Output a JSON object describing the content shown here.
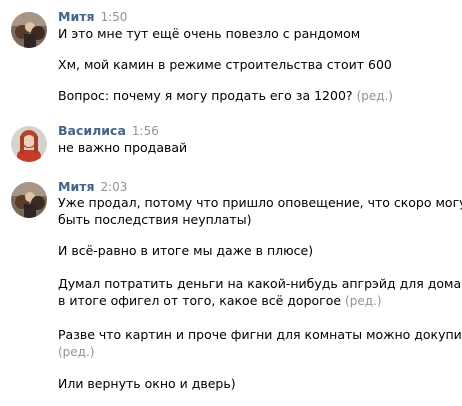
{
  "messages": [
    {
      "author": "Митя",
      "time": "1:50",
      "lines": [
        "И это мне тут ещё очень повезло с рандомом",
        "Хм, мой камин в режиме строительства стоит 600",
        "Вопрос: почему я могу продать его за 1200?"
      ],
      "edited_label": "(ред.)"
    },
    {
      "author": "Василиса",
      "time": "1:56",
      "lines": [
        "не важно продавай"
      ]
    },
    {
      "author": "Митя",
      "time": "2:03",
      "lines": [
        "Уже продал, потому что пришло оповещение, что скоро могут",
        "быть последствия неуплаты)",
        "И всё-равно в итоге мы даже в плюсе)",
        "Думал потратить деньги на какой-нибудь апгрэйд для дома, а",
        "в итоге офигел от того, какое всё дорогое",
        "Разве что картин и проче фигни для комнаты можно докупить",
        "Или вернуть окно и дверь)"
      ],
      "edited_label": "(ред.)"
    }
  ],
  "colors": {
    "author": "#42648b",
    "meta": "#939393",
    "text": "#000000"
  }
}
